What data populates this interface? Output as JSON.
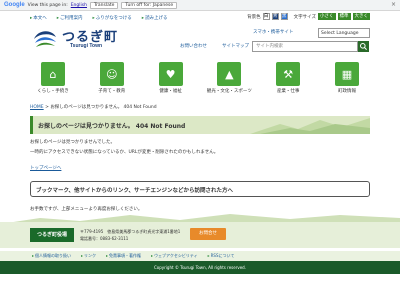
{
  "translate_bar": {
    "logo": "Google",
    "prompt": "View this page in:",
    "language": "English",
    "translate_label": "Translate",
    "turn_off_label": "Turn off for: Japanese",
    "close": "×"
  },
  "utility": {
    "links": [
      "本文へ",
      "ご利用案内",
      "ふりがなをつける",
      "読み上げる"
    ],
    "color_label": "背景色",
    "color_chips": [
      "白",
      "青",
      "黒"
    ],
    "size_label": "文字サイズ",
    "size_buttons": [
      "小さく",
      "標準",
      "大きく"
    ]
  },
  "header": {
    "logo_text": "つるぎ町",
    "logo_sub": "Tsurugi Town",
    "smartphone_link": "スマホ・携帯サイト",
    "language_select": "Select Language",
    "contact_link": "お問い合わせ",
    "sitemap_link": "サイトマップ",
    "search_placeholder": "サイト内検索"
  },
  "nav": {
    "items": [
      {
        "label": "くらし・手続き",
        "icon": "house-icon"
      },
      {
        "label": "子育て・教育",
        "icon": "child-icon"
      },
      {
        "label": "健康・福祉",
        "icon": "heart-icon"
      },
      {
        "label": "観光・文化・スポーツ",
        "icon": "mountain-icon"
      },
      {
        "label": "産業・仕事",
        "icon": "industry-icon"
      },
      {
        "label": "町政情報",
        "icon": "building-icon"
      }
    ]
  },
  "breadcrumb": {
    "home": "HOME",
    "current": "お探しのページは見つかりません。 404 Not Found"
  },
  "main": {
    "title": "お探しのページは見つかりません。 404 Not Found",
    "para1": "お探しのページは見つかりませんでした。",
    "para2": "一時的にアクセスできない状態になっているか、URLが変更・削除されたのかもしれません。",
    "top_link": "トップページへ",
    "info_box": "ブックマーク、他サイトからのリンク、サーチエンジンなどから訪問された方へ",
    "para3": "お手数ですが、上部メニューより再度お探しください。"
  },
  "footer": {
    "office_name": "つるぎ町役場",
    "address": "〒779-4195　徳島県美馬郡つるぎ町貞光字東浦1番地1",
    "phone": "電話番号：0883-62-3111",
    "contact_button": "お問合せ",
    "links": [
      "個人情報の取り扱い",
      "リンク",
      "免責事項・著作権",
      "ウェブアクセシビリティ",
      "RSSについて"
    ],
    "copyright": "Copyright © Tsurugi Town, All rights reserved."
  },
  "colors": {
    "brand_green": "#3a8a2a",
    "dark_green": "#1a5a2a",
    "nav_icon_green": "#4aa83a",
    "title_bg": "#dce8c6",
    "accent_orange": "#e88a2a"
  }
}
